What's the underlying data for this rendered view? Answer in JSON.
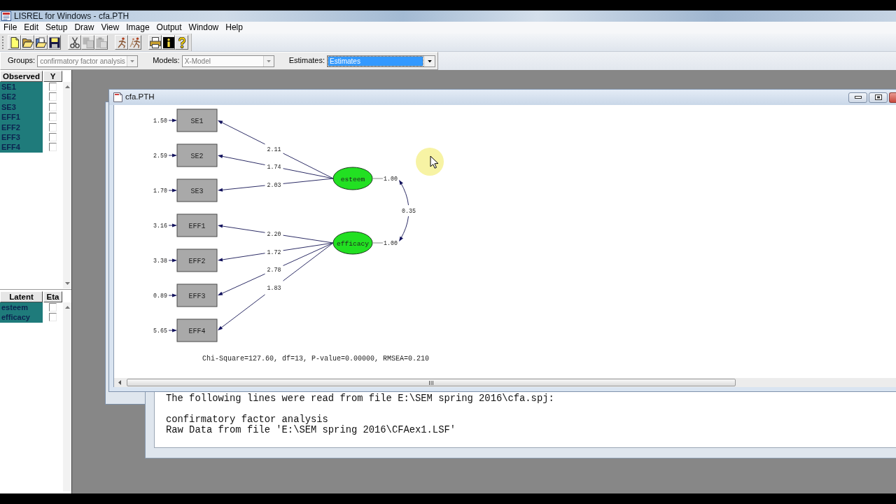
{
  "window": {
    "title": "LISREL for Windows - cfa.PTH"
  },
  "menu": [
    "File",
    "Edit",
    "Setup",
    "Draw",
    "View",
    "Image",
    "Output",
    "Window",
    "Help"
  ],
  "toolbar": [
    [
      {
        "kind": "new",
        "disabled": false
      },
      {
        "kind": "open",
        "disabled": false
      },
      {
        "kind": "import",
        "disabled": false
      },
      {
        "kind": "save",
        "disabled": false
      }
    ],
    [
      {
        "kind": "cut",
        "disabled": false
      },
      {
        "kind": "copy",
        "disabled": true
      },
      {
        "kind": "paste",
        "disabled": true
      }
    ],
    [
      {
        "kind": "run",
        "disabled": false
      },
      {
        "kind": "rerun",
        "disabled": false
      }
    ],
    [
      {
        "kind": "print",
        "disabled": false
      },
      {
        "kind": "info",
        "disabled": false
      },
      {
        "kind": "help",
        "disabled": false
      }
    ]
  ],
  "filters": [
    {
      "label": "Groups:",
      "value": "confirmatory factor analysis",
      "disabled": true,
      "focused": false
    },
    {
      "label": "Models:",
      "value": "X-Model",
      "disabled": true,
      "focused": false
    },
    {
      "label": "Estimates:",
      "value": "Estimates",
      "disabled": false,
      "focused": true
    }
  ],
  "observed_list": {
    "columns": [
      "Observed",
      "Y"
    ],
    "items": [
      {
        "label": "SE1",
        "selected": true,
        "checked": false
      },
      {
        "label": "SE2",
        "selected": true,
        "checked": false
      },
      {
        "label": "SE3",
        "selected": true,
        "checked": false
      },
      {
        "label": "EFF1",
        "selected": true,
        "checked": false
      },
      {
        "label": "EFF2",
        "selected": true,
        "checked": false
      },
      {
        "label": "EFF3",
        "selected": true,
        "checked": false
      },
      {
        "label": "EFF4",
        "selected": true,
        "checked": false
      }
    ]
  },
  "latent_list": {
    "columns": [
      "Latent",
      "Eta"
    ],
    "items": [
      {
        "label": "esteem",
        "selected": true,
        "checked": false
      },
      {
        "label": "efficacy",
        "selected": true,
        "checked": false
      }
    ]
  },
  "path_window": {
    "title": "cfa.PTH",
    "diagram": {
      "factors": [
        {
          "label": "esteem",
          "variance": "1.00",
          "indicators": [
            {
              "label": "SE1",
              "loading": "2.11",
              "error_variance": "1.50"
            },
            {
              "label": "SE2",
              "loading": "1.74",
              "error_variance": "2.59"
            },
            {
              "label": "SE3",
              "loading": "2.03",
              "error_variance": "1.70"
            }
          ]
        },
        {
          "label": "efficacy",
          "variance": "1.00",
          "indicators": [
            {
              "label": "EFF1",
              "loading": "2.20",
              "error_variance": "3.16"
            },
            {
              "label": "EFF2",
              "loading": "1.72",
              "error_variance": "3.38"
            },
            {
              "label": "EFF3",
              "loading": "2.78",
              "error_variance": "0.89"
            },
            {
              "label": "EFF4",
              "loading": "1.83",
              "error_variance": "5.65"
            }
          ]
        }
      ],
      "covariance": "0.35",
      "fit_statistics": "Chi-Square=127.60, df=13, P-value=0.00000, RMSEA=0.210"
    }
  },
  "output_window": {
    "blocks": [
      [
        "The following lines were read from file E:\\SEM spring 2016\\cfa.spj:"
      ],
      [
        "confirmatory factor analysis",
        "Raw Data from file 'E:\\SEM spring 2016\\CFAex1.LSF'"
      ]
    ]
  }
}
